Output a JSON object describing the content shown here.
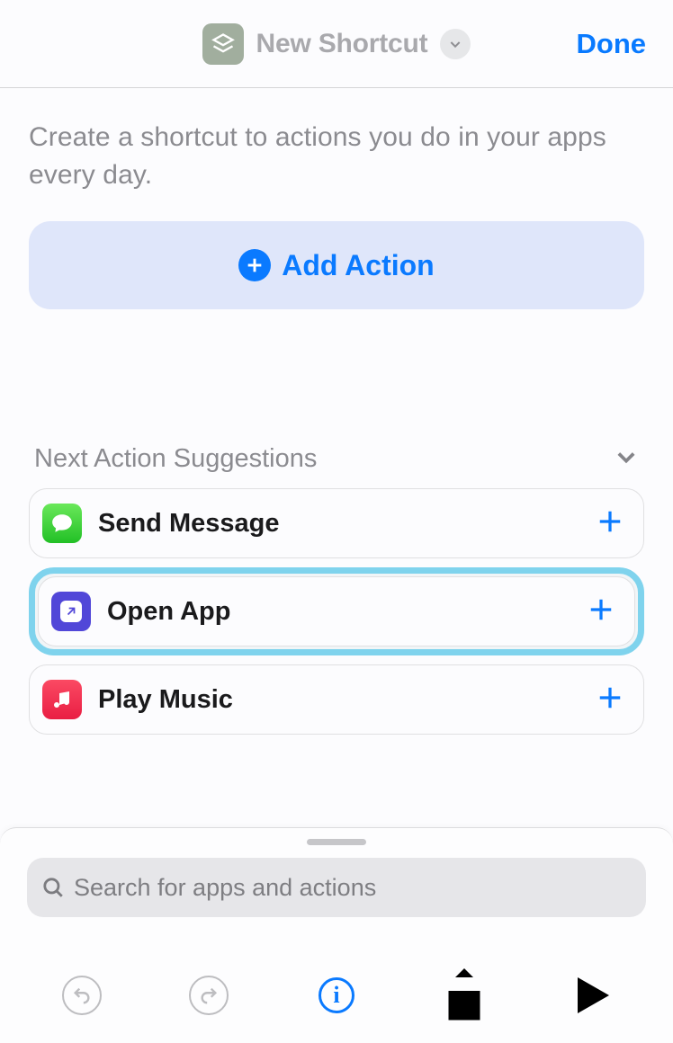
{
  "header": {
    "title": "New Shortcut",
    "done_label": "Done"
  },
  "intro_text": "Create a shortcut to actions you do in your apps every day.",
  "add_action_label": "Add Action",
  "suggestions": {
    "title": "Next Action Suggestions",
    "items": [
      {
        "label": "Send Message",
        "icon": "messages",
        "highlighted": false
      },
      {
        "label": "Open App",
        "icon": "openapp",
        "highlighted": true
      },
      {
        "label": "Play Music",
        "icon": "music",
        "highlighted": false
      }
    ]
  },
  "search": {
    "placeholder": "Search for apps and actions"
  },
  "toolbar": {
    "undo": "undo",
    "redo": "redo",
    "info": "info",
    "share": "share",
    "play": "play"
  }
}
